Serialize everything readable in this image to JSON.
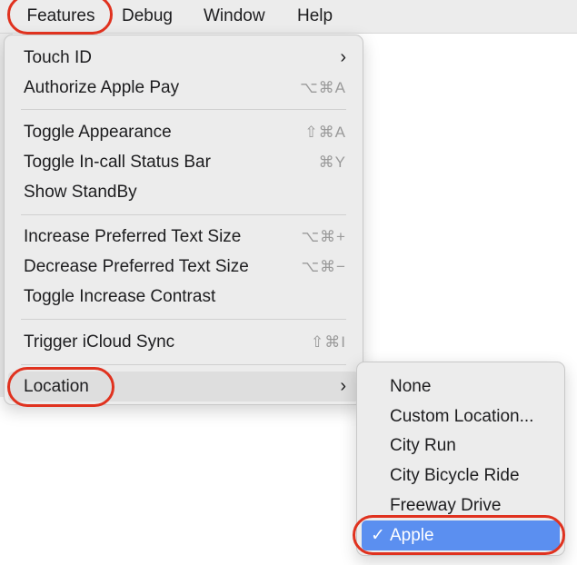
{
  "menubar": {
    "items": [
      {
        "label": "Features"
      },
      {
        "label": "Debug"
      },
      {
        "label": "Window"
      },
      {
        "label": "Help"
      }
    ]
  },
  "features_menu": {
    "items": [
      {
        "label": "Touch ID",
        "submenu_icon": "chevron-right-icon"
      },
      {
        "label": "Authorize Apple Pay",
        "shortcut": "⌥⌘A"
      },
      {
        "label": "Toggle Appearance",
        "shortcut": "⇧⌘A"
      },
      {
        "label": "Toggle In-call Status Bar",
        "shortcut": "⌘Y"
      },
      {
        "label": "Show StandBy"
      },
      {
        "label": "Increase Preferred Text Size",
        "shortcut": "⌥⌘+"
      },
      {
        "label": "Decrease Preferred Text Size",
        "shortcut": "⌥⌘−"
      },
      {
        "label": "Toggle Increase Contrast"
      },
      {
        "label": "Trigger iCloud Sync",
        "shortcut": "⇧⌘I"
      },
      {
        "label": "Location",
        "submenu_icon": "chevron-right-icon"
      }
    ],
    "arrow": "›"
  },
  "location_submenu": {
    "items": [
      {
        "label": "None"
      },
      {
        "label": "Custom Location..."
      },
      {
        "label": "City Run"
      },
      {
        "label": "City Bicycle Ride"
      },
      {
        "label": "Freeway Drive"
      },
      {
        "label": "Apple",
        "selected": true
      }
    ],
    "check": "✓"
  },
  "colors": {
    "selection": "#5b8ff0",
    "annotation": "#e0321f",
    "menu_bg": "#ececec"
  }
}
